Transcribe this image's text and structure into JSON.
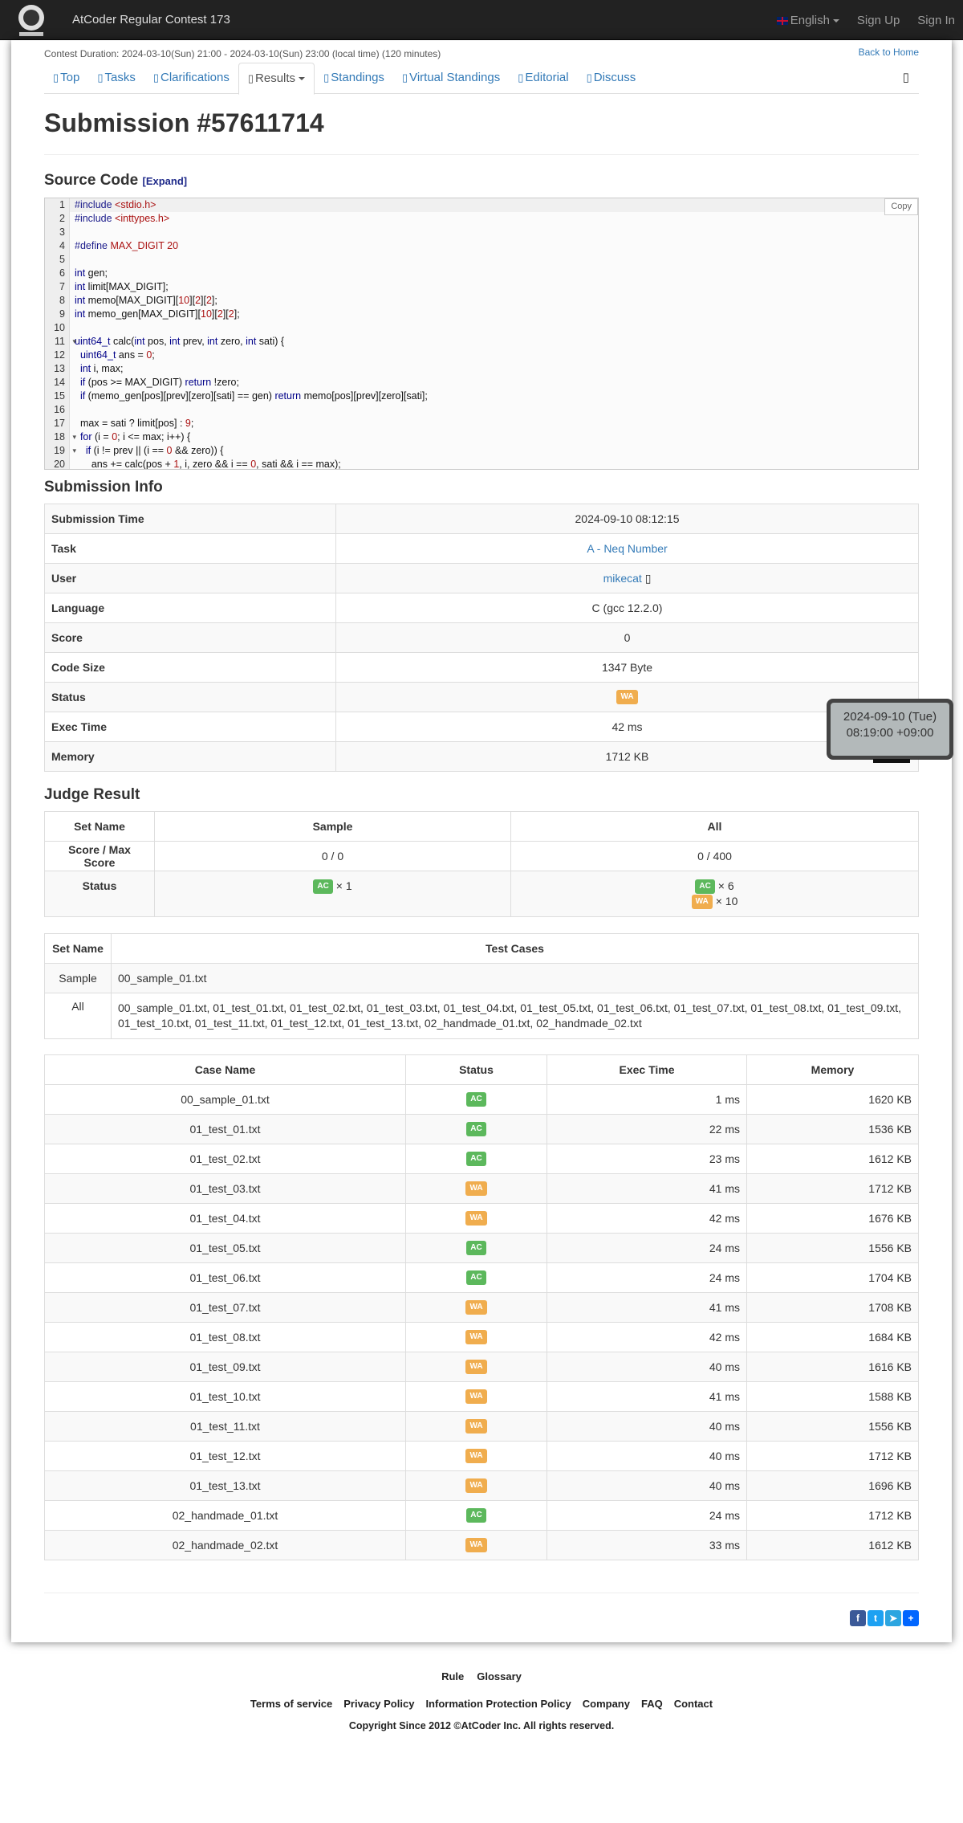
{
  "nav": {
    "brand": "AtCoder Regular Contest 173",
    "language": "English",
    "signup": "Sign Up",
    "signin": "Sign In"
  },
  "contest": {
    "duration": "Contest Duration: 2024-03-10(Sun) 21:00 - 2024-03-10(Sun) 23:00 (local time) (120 minutes)",
    "back_home": "Back to Home"
  },
  "tabs": [
    {
      "label": "Top",
      "icon": "home-icon"
    },
    {
      "label": "Tasks",
      "icon": "tasks-icon"
    },
    {
      "label": "Clarifications",
      "icon": "question-icon"
    },
    {
      "label": "Results",
      "icon": "results-icon"
    },
    {
      "label": "Standings",
      "icon": "standings-icon"
    },
    {
      "label": "Virtual Standings",
      "icon": "virtual-standings-icon"
    },
    {
      "label": "Editorial",
      "icon": "editorial-icon"
    },
    {
      "label": "Discuss",
      "icon": "discuss-icon"
    }
  ],
  "page": {
    "title": "Submission #57611714"
  },
  "source": {
    "title": "Source Code",
    "expand": "[Expand]",
    "copy": "Copy",
    "lines": [
      "#include <stdio.h>",
      "#include <inttypes.h>",
      "",
      "#define MAX_DIGIT 20",
      "",
      "int gen;",
      "int limit[MAX_DIGIT];",
      "int memo[MAX_DIGIT][10][2][2];",
      "int memo_gen[MAX_DIGIT][10][2][2];",
      "",
      "uint64_t calc(int pos, int prev, int zero, int sati) {",
      "  uint64_t ans = 0;",
      "  int i, max;",
      "  if (pos >= MAX_DIGIT) return !zero;",
      "  if (memo_gen[pos][prev][zero][sati] == gen) return memo[pos][prev][zero][sati];",
      "",
      "  max = sati ? limit[pos] : 9;",
      "  for (i = 0; i <= max; i++) {",
      "    if (i != prev || (i == 0 && zero)) {",
      "      ans += calc(pos + 1, i, zero && i == 0, sati && i == max);"
    ]
  },
  "info": {
    "title": "Submission Info",
    "rows": [
      {
        "k": "Submission Time",
        "v": "2024-09-10 08:12:15"
      },
      {
        "k": "Task",
        "v": "A - Neq Number"
      },
      {
        "k": "User",
        "v": "mikecat"
      },
      {
        "k": "Language",
        "v": "C (gcc 12.2.0)"
      },
      {
        "k": "Score",
        "v": "0"
      },
      {
        "k": "Code Size",
        "v": "1347 Byte"
      },
      {
        "k": "Status",
        "v": "WA"
      },
      {
        "k": "Exec Time",
        "v": "42 ms"
      },
      {
        "k": "Memory",
        "v": "1712 KB"
      }
    ]
  },
  "tooltip": {
    "line1": "2024-09-10 (Tue)",
    "line2": "08:19:00 +09:00"
  },
  "judge": {
    "title": "Judge Result",
    "headers": [
      "Set Name",
      "Sample",
      "All"
    ],
    "score_label": "Score / Max Score",
    "sample_score": "0 / 0",
    "all_score": "0 / 400",
    "status_label": "Status",
    "sample_ac": "AC",
    "sample_ac_count": "× 1",
    "all_ac": "AC",
    "all_ac_count": "× 6",
    "all_wa": "WA",
    "all_wa_count": "× 10"
  },
  "sets": {
    "headers": [
      "Set Name",
      "Test Cases"
    ],
    "rows": [
      {
        "name": "Sample",
        "cases": "00_sample_01.txt"
      },
      {
        "name": "All",
        "cases": "00_sample_01.txt, 01_test_01.txt, 01_test_02.txt, 01_test_03.txt, 01_test_04.txt, 01_test_05.txt, 01_test_06.txt, 01_test_07.txt, 01_test_08.txt, 01_test_09.txt, 01_test_10.txt, 01_test_11.txt, 01_test_12.txt, 01_test_13.txt, 02_handmade_01.txt, 02_handmade_02.txt"
      }
    ]
  },
  "cases": {
    "headers": [
      "Case Name",
      "Status",
      "Exec Time",
      "Memory"
    ],
    "rows": [
      {
        "name": "00_sample_01.txt",
        "status": "AC",
        "time": "1 ms",
        "mem": "1620 KB"
      },
      {
        "name": "01_test_01.txt",
        "status": "AC",
        "time": "22 ms",
        "mem": "1536 KB"
      },
      {
        "name": "01_test_02.txt",
        "status": "AC",
        "time": "23 ms",
        "mem": "1612 KB"
      },
      {
        "name": "01_test_03.txt",
        "status": "WA",
        "time": "41 ms",
        "mem": "1712 KB"
      },
      {
        "name": "01_test_04.txt",
        "status": "WA",
        "time": "42 ms",
        "mem": "1676 KB"
      },
      {
        "name": "01_test_05.txt",
        "status": "AC",
        "time": "24 ms",
        "mem": "1556 KB"
      },
      {
        "name": "01_test_06.txt",
        "status": "AC",
        "time": "24 ms",
        "mem": "1704 KB"
      },
      {
        "name": "01_test_07.txt",
        "status": "WA",
        "time": "41 ms",
        "mem": "1708 KB"
      },
      {
        "name": "01_test_08.txt",
        "status": "WA",
        "time": "42 ms",
        "mem": "1684 KB"
      },
      {
        "name": "01_test_09.txt",
        "status": "WA",
        "time": "40 ms",
        "mem": "1616 KB"
      },
      {
        "name": "01_test_10.txt",
        "status": "WA",
        "time": "41 ms",
        "mem": "1588 KB"
      },
      {
        "name": "01_test_11.txt",
        "status": "WA",
        "time": "40 ms",
        "mem": "1556 KB"
      },
      {
        "name": "01_test_12.txt",
        "status": "WA",
        "time": "40 ms",
        "mem": "1712 KB"
      },
      {
        "name": "01_test_13.txt",
        "status": "WA",
        "time": "40 ms",
        "mem": "1696 KB"
      },
      {
        "name": "02_handmade_01.txt",
        "status": "AC",
        "time": "24 ms",
        "mem": "1712 KB"
      },
      {
        "name": "02_handmade_02.txt",
        "status": "WA",
        "time": "33 ms",
        "mem": "1612 KB"
      }
    ]
  },
  "footer": {
    "links1": [
      "Rule",
      "Glossary"
    ],
    "links2": [
      "Terms of service",
      "Privacy Policy",
      "Information Protection Policy",
      "Company",
      "FAQ",
      "Contact"
    ],
    "copyright": "Copyright Since 2012 ©AtCoder Inc. All rights reserved."
  },
  "colors": {
    "ac": "#5cb85c",
    "wa": "#f0ad4e",
    "link": "#337ab7",
    "navbar": "#222222"
  }
}
